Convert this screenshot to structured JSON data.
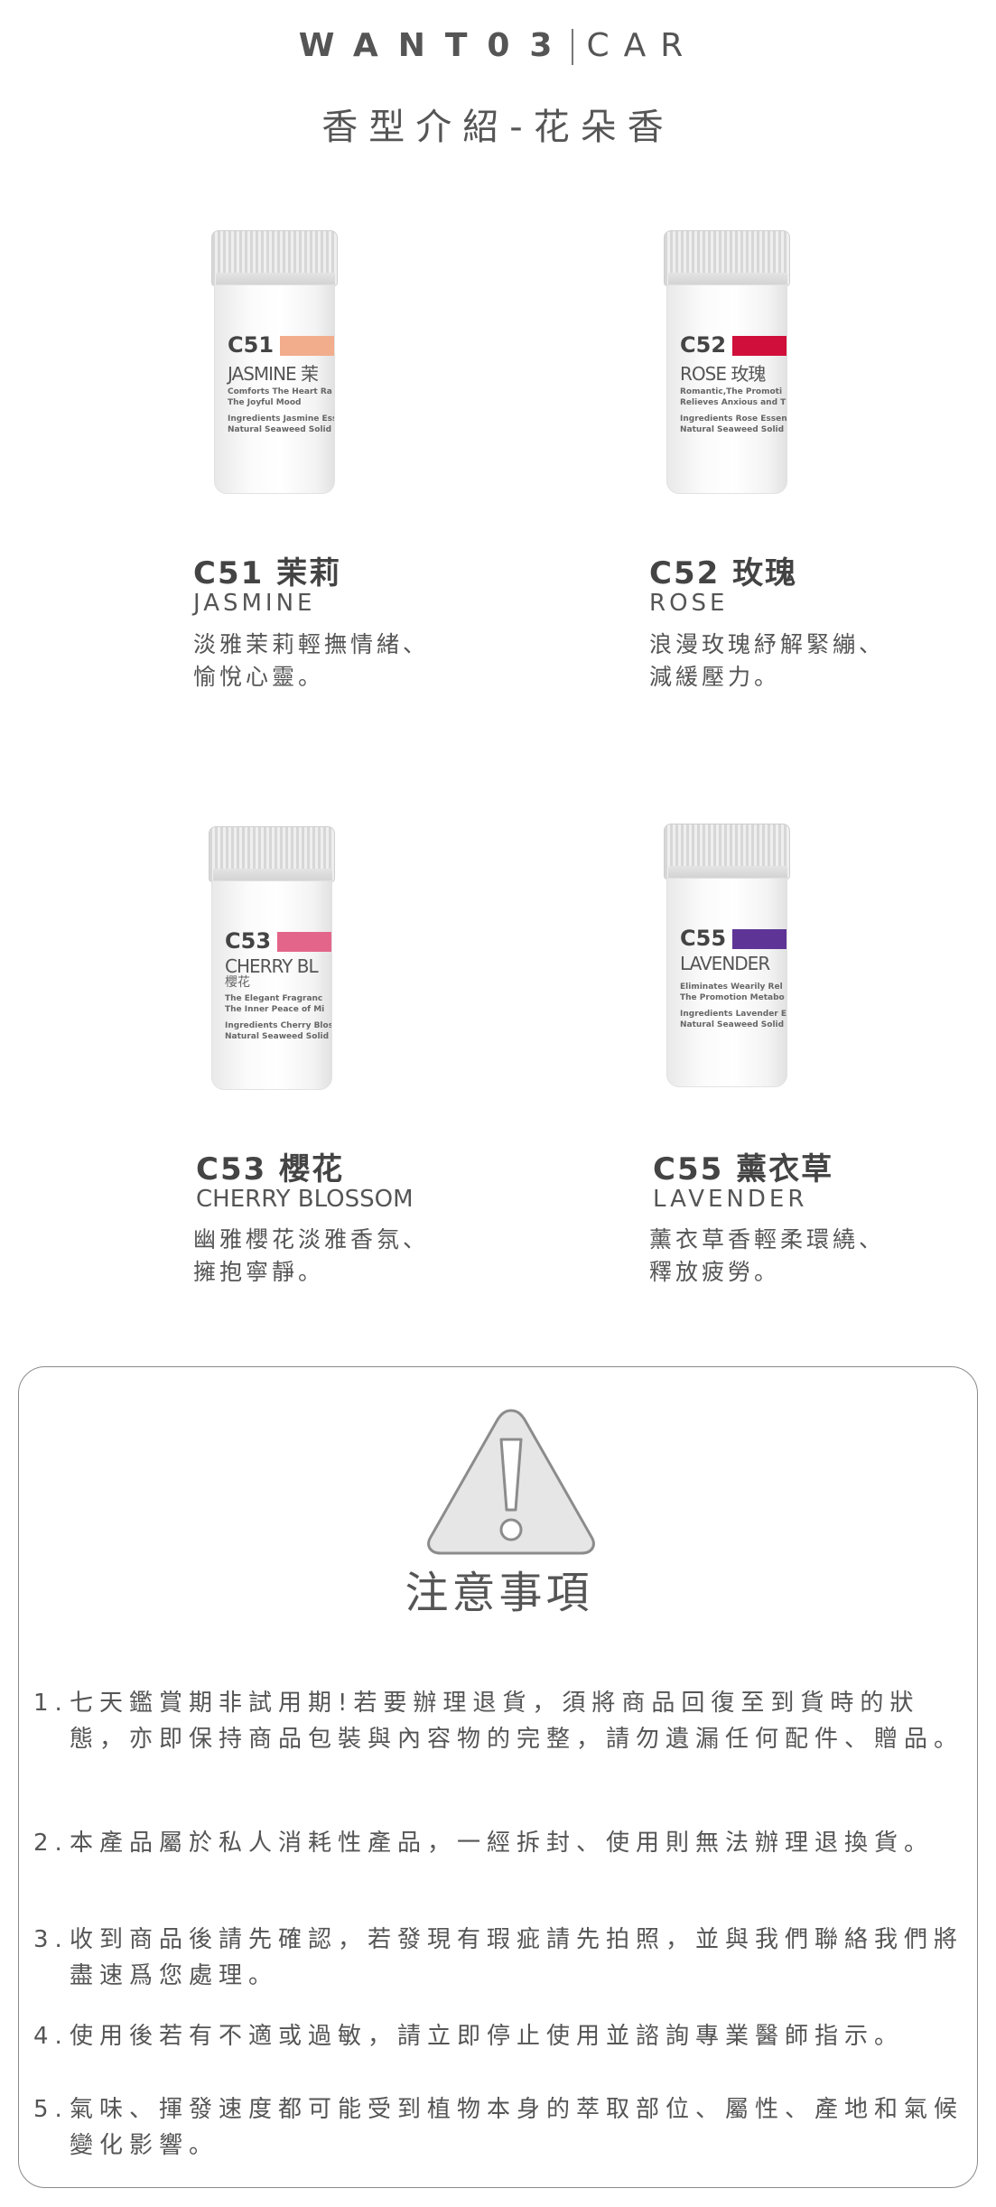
{
  "header": {
    "brand": "WANT03",
    "brand_suffix": "CAR",
    "subtitle": "香型介紹-花朵香"
  },
  "products": [
    {
      "code": "C51",
      "title": "C51 茉莉",
      "en": "JASMINE",
      "desc_line1": "淡雅茉莉輕撫情緒、",
      "desc_line2": "愉悅心靈。",
      "label_name": "JASMINE 茉",
      "label_line1": "Comforts The Heart Ra",
      "label_line2": "The Joyful Mood",
      "label_line3": "Ingredients Jasmine Ess",
      "label_line4": "Natural Seaweed Solid T",
      "color": "#f2ad8c"
    },
    {
      "code": "C52",
      "title": "C52 玫瑰",
      "en": "ROSE",
      "desc_line1": "浪漫玫瑰紓解緊繃、",
      "desc_line2": "減緩壓力。",
      "label_name": "ROSE 玫瑰",
      "label_line1": "Romantic,The Promoti",
      "label_line2": "Relieves Anxious and T",
      "label_line3": "Ingredients Rose Essent",
      "label_line4": "Natural Seaweed Solid T",
      "color": "#d0103a"
    },
    {
      "code": "C53",
      "title": "C53 櫻花",
      "en": "CHERRY BLOSSOM",
      "desc_line1": "幽雅櫻花淡雅香氛、",
      "desc_line2": "擁抱寧靜。",
      "label_name": "CHERRY BL",
      "label_sub": "櫻花",
      "label_line1": "The Elegant Fragranc",
      "label_line2": "The Inner Peace of Mi",
      "label_line3": "Ingredients Cherry Blos",
      "label_line4": "Natural Seaweed Solid T",
      "color": "#e3658a"
    },
    {
      "code": "C55",
      "title": "C55 薰衣草",
      "en": "LAVENDER",
      "desc_line1": "薰衣草香輕柔環繞、",
      "desc_line2": "釋放疲勞。",
      "label_name": "LAVENDER",
      "label_line1": "Eliminates Wearily Rel",
      "label_line2": "The Promotion Metabo",
      "label_line3": "Ingredients Lavender Es",
      "label_line4": "Natural Seaweed Solid T",
      "color": "#5e3596"
    }
  ],
  "notice": {
    "title": "注意事項",
    "items": [
      {
        "num": "1.",
        "text": "七天鑑賞期非試用期!若要辦理退貨，須將商品回復至到貨時的狀態，亦即保持商品包裝與內容物的完整，請勿遺漏任何配件、贈品。"
      },
      {
        "num": "2.",
        "text": "本產品屬於私人消耗性產品，一經拆封、使用則無法辦理退換貨。"
      },
      {
        "num": "3.",
        "text": "收到商品後請先確認，若發現有瑕疵請先拍照，並與我們聯絡我們將盡速爲您處理。"
      },
      {
        "num": "4.",
        "text": "使用後若有不適或過敏，請立即停止使用並諮詢專業醫師指示。"
      },
      {
        "num": "5.",
        "text": "氣味、揮發速度都可能受到植物本身的萃取部位、屬性、產地和氣候變化影響。"
      }
    ]
  }
}
